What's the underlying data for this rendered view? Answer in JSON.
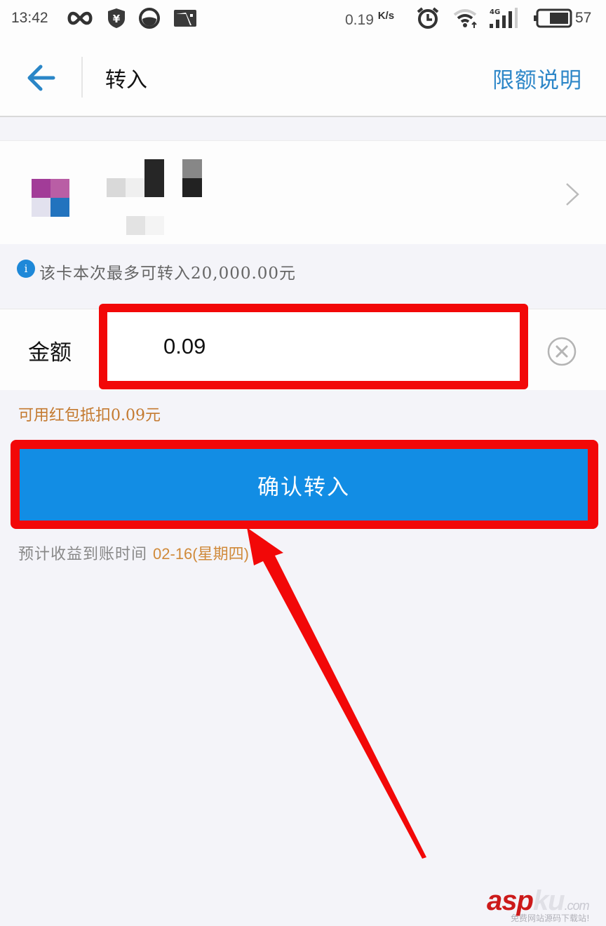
{
  "status_bar": {
    "time": "13:42",
    "network_speed": "0.19",
    "network_speed_unit": "K/s",
    "network_type": "4G",
    "battery_percent": "57",
    "icons": [
      "infinity-icon",
      "yuan-shield-icon",
      "half-circle-icon",
      "image-notification-icon",
      "alarm-icon",
      "wifi-icon",
      "signal-icon",
      "battery-icon"
    ]
  },
  "nav": {
    "back_icon": "arrow-left-icon",
    "title": "转入",
    "action_label": "限额说明"
  },
  "card": {
    "bank_name": "(pixelated)",
    "card_detail": "(pixelated)",
    "chevron_icon": "chevron-right-icon"
  },
  "limit_note": {
    "icon_glyph": "i",
    "text": "该卡本次最多可转入20,000.00元"
  },
  "amount": {
    "label": "金额",
    "value": "0.09",
    "clear_icon": "clear-circle-icon"
  },
  "redpacket_note": "可用红包抵扣0.09元",
  "confirm_button": "确认转入",
  "eta": {
    "label": "预计收益到账时间",
    "date": "02-16(星期四)"
  },
  "watermark": {
    "brand_a": "asp",
    "brand_b": "ku",
    "suffix": ".com",
    "subtitle": "免费网站源码下载站!"
  },
  "colors": {
    "accent_blue": "#128de4",
    "link_blue": "#2e87c8",
    "highlight_red": "#f20808",
    "orange_text": "#c47a30",
    "background": "#f4f4f9"
  }
}
